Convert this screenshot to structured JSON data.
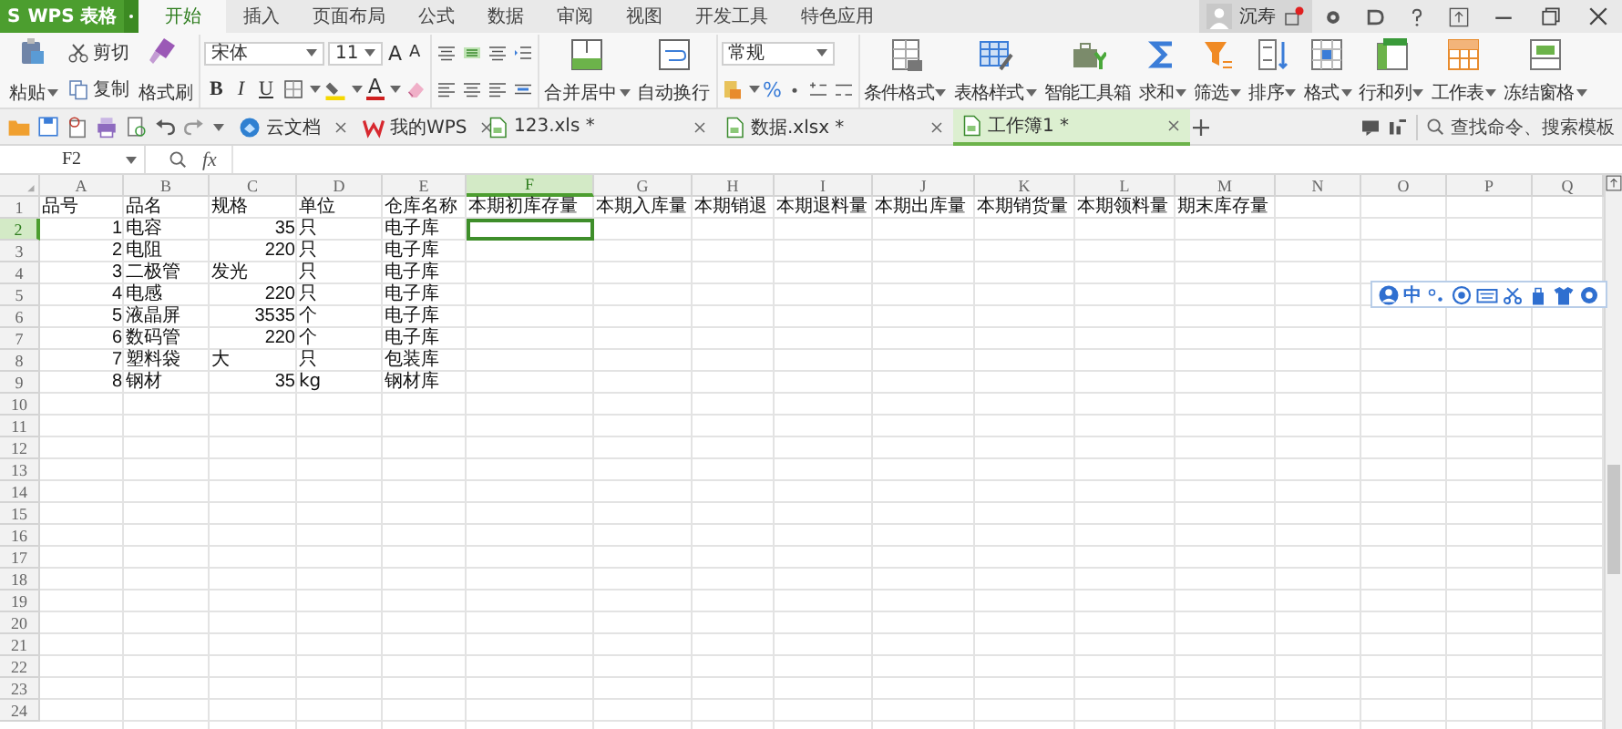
{
  "app": {
    "logo_mark": "S",
    "name": "WPS 表格"
  },
  "menu_tabs": [
    {
      "label": "开始",
      "selected": true
    },
    {
      "label": "插入",
      "selected": false
    },
    {
      "label": "页面布局",
      "selected": false
    },
    {
      "label": "公式",
      "selected": false
    },
    {
      "label": "数据",
      "selected": false
    },
    {
      "label": "审阅",
      "selected": false
    },
    {
      "label": "视图",
      "selected": false
    },
    {
      "label": "开发工具",
      "selected": false
    },
    {
      "label": "特色应用",
      "selected": false
    }
  ],
  "account": {
    "user": "沉寿"
  },
  "ribbon": {
    "paste": "粘贴",
    "cut": "剪切",
    "copy": "复制",
    "format_painter": "格式刷",
    "font_name": "宋体",
    "font_size": "11",
    "grow_font": "A",
    "shrink_font": "A",
    "bold": "B",
    "italic": "I",
    "underline": "U",
    "font_color": "A",
    "merge": "合并居中",
    "wrap_text": "自动换行",
    "number_format": "常规",
    "percent": "%",
    "tools": [
      {
        "kind": "conditional",
        "label": "条件格式",
        "dropdown": true
      },
      {
        "kind": "table_style",
        "label": "表格样式",
        "dropdown": true
      },
      {
        "kind": "toolbox",
        "label": "智能工具箱",
        "dropdown": false
      },
      {
        "kind": "sum",
        "label": "求和",
        "dropdown": true
      },
      {
        "kind": "filter",
        "label": "筛选",
        "dropdown": true
      },
      {
        "kind": "sort",
        "label": "排序",
        "dropdown": true
      },
      {
        "kind": "format",
        "label": "格式",
        "dropdown": true
      },
      {
        "kind": "rowcol",
        "label": "行和列",
        "dropdown": true
      },
      {
        "kind": "sheet",
        "label": "工作表",
        "dropdown": true
      },
      {
        "kind": "freeze",
        "label": "冻结窗格",
        "dropdown": true
      }
    ]
  },
  "doc_tabs": [
    {
      "kind": "cloud",
      "label": "云文档",
      "selected": false
    },
    {
      "kind": "wps",
      "label": "我的WPS",
      "selected": false
    },
    {
      "kind": "file",
      "label": "123.xls *",
      "selected": false
    },
    {
      "kind": "file",
      "label": "数据.xlsx *",
      "selected": false
    },
    {
      "kind": "file",
      "label": "工作簿1 *",
      "selected": true
    }
  ],
  "search": {
    "placeholder": "查找命令、搜索模板"
  },
  "formula_bar": {
    "cell": "F2",
    "fx": "fx"
  },
  "sheet": {
    "columns": [
      {
        "label": "A",
        "selected": false
      },
      {
        "label": "B",
        "selected": false
      },
      {
        "label": "C",
        "selected": false
      },
      {
        "label": "D",
        "selected": false
      },
      {
        "label": "E",
        "selected": false
      },
      {
        "label": "F",
        "selected": true
      },
      {
        "label": "G",
        "selected": false
      },
      {
        "label": "H",
        "selected": false
      },
      {
        "label": "I",
        "selected": false
      },
      {
        "label": "J",
        "selected": false
      },
      {
        "label": "K",
        "selected": false
      },
      {
        "label": "L",
        "selected": false
      },
      {
        "label": "M",
        "selected": false
      },
      {
        "label": "N",
        "selected": false
      },
      {
        "label": "O",
        "selected": false
      },
      {
        "label": "P",
        "selected": false
      },
      {
        "label": "Q",
        "selected": false
      }
    ],
    "rows": [
      {
        "number": "1",
        "selected": false,
        "cells": [
          {
            "text": "品号",
            "kind": "text"
          },
          {
            "text": "品名",
            "kind": "text"
          },
          {
            "text": "规格",
            "kind": "text"
          },
          {
            "text": "单位",
            "kind": "text"
          },
          {
            "text": "仓库名称",
            "kind": "text"
          },
          {
            "text": "本期初库存量",
            "kind": "text"
          },
          {
            "text": "本期入库量",
            "kind": "text"
          },
          {
            "text": "本期销退",
            "kind": "text"
          },
          {
            "text": "本期退料量",
            "kind": "text"
          },
          {
            "text": "本期出库量",
            "kind": "text"
          },
          {
            "text": "本期销货量",
            "kind": "text"
          },
          {
            "text": "本期领料量",
            "kind": "text"
          },
          {
            "text": "期末库存量",
            "kind": "text"
          }
        ]
      },
      {
        "number": "2",
        "selected": true,
        "cells": [
          {
            "text": "1",
            "kind": "number"
          },
          {
            "text": "电容",
            "kind": "text"
          },
          {
            "text": "35",
            "kind": "number"
          },
          {
            "text": "只",
            "kind": "text"
          },
          {
            "text": "电子库",
            "kind": "text"
          }
        ]
      },
      {
        "number": "3",
        "selected": false,
        "cells": [
          {
            "text": "2",
            "kind": "number"
          },
          {
            "text": "电阻",
            "kind": "text"
          },
          {
            "text": "220",
            "kind": "number"
          },
          {
            "text": "只",
            "kind": "text"
          },
          {
            "text": "电子库",
            "kind": "text"
          }
        ]
      },
      {
        "number": "4",
        "selected": false,
        "cells": [
          {
            "text": "3",
            "kind": "number"
          },
          {
            "text": "二极管",
            "kind": "text"
          },
          {
            "text": "发光",
            "kind": "text"
          },
          {
            "text": "只",
            "kind": "text"
          },
          {
            "text": "电子库",
            "kind": "text"
          }
        ]
      },
      {
        "number": "5",
        "selected": false,
        "cells": [
          {
            "text": "4",
            "kind": "number"
          },
          {
            "text": "电感",
            "kind": "text"
          },
          {
            "text": "220",
            "kind": "number"
          },
          {
            "text": "只",
            "kind": "text"
          },
          {
            "text": "电子库",
            "kind": "text"
          }
        ]
      },
      {
        "number": "6",
        "selected": false,
        "cells": [
          {
            "text": "5",
            "kind": "number"
          },
          {
            "text": "液晶屏",
            "kind": "text"
          },
          {
            "text": "3535",
            "kind": "number"
          },
          {
            "text": "个",
            "kind": "text"
          },
          {
            "text": "电子库",
            "kind": "text"
          }
        ]
      },
      {
        "number": "7",
        "selected": false,
        "cells": [
          {
            "text": "6",
            "kind": "number"
          },
          {
            "text": "数码管",
            "kind": "text"
          },
          {
            "text": "220",
            "kind": "number"
          },
          {
            "text": "个",
            "kind": "text"
          },
          {
            "text": "电子库",
            "kind": "text"
          }
        ]
      },
      {
        "number": "8",
        "selected": false,
        "cells": [
          {
            "text": "7",
            "kind": "number"
          },
          {
            "text": "塑料袋",
            "kind": "text"
          },
          {
            "text": "大",
            "kind": "text"
          },
          {
            "text": "只",
            "kind": "text"
          },
          {
            "text": "包装库",
            "kind": "text"
          }
        ]
      },
      {
        "number": "9",
        "selected": false,
        "cells": [
          {
            "text": "8",
            "kind": "number"
          },
          {
            "text": "钢材",
            "kind": "text"
          },
          {
            "text": "35",
            "kind": "number"
          },
          {
            "text": "kg",
            "kind": "text"
          },
          {
            "text": "钢材库",
            "kind": "text"
          }
        ]
      },
      {
        "number": "10",
        "selected": false
      },
      {
        "number": "11",
        "selected": false
      },
      {
        "number": "12",
        "selected": false
      },
      {
        "number": "13",
        "selected": false
      },
      {
        "number": "14",
        "selected": false
      },
      {
        "number": "15",
        "selected": false
      },
      {
        "number": "16",
        "selected": false
      },
      {
        "number": "17",
        "selected": false
      },
      {
        "number": "18",
        "selected": false
      },
      {
        "number": "19",
        "selected": false
      },
      {
        "number": "20",
        "selected": false
      },
      {
        "number": "21",
        "selected": false
      },
      {
        "number": "22",
        "selected": false
      },
      {
        "number": "23",
        "selected": false
      },
      {
        "number": "24",
        "selected": false
      }
    ]
  },
  "ime_toolbar": {
    "mode": "中"
  }
}
